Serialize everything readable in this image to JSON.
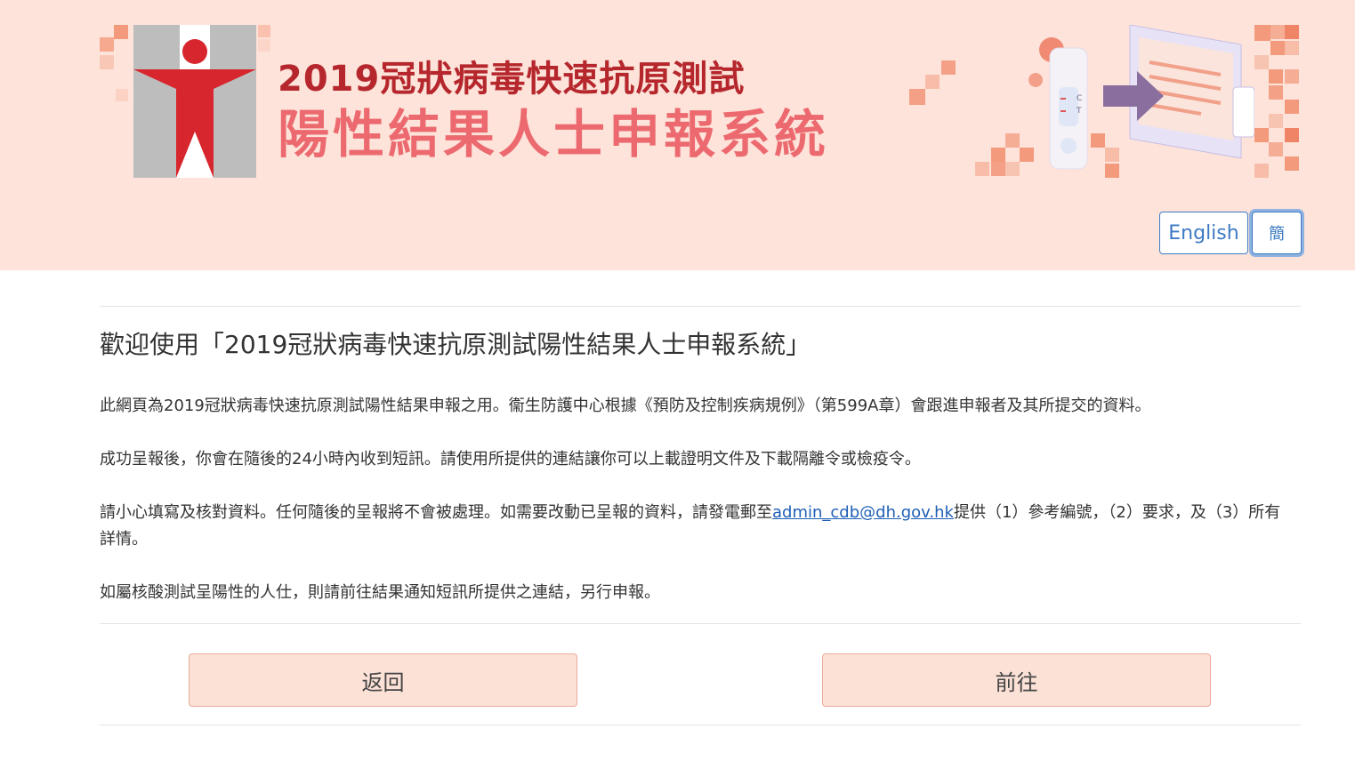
{
  "header": {
    "title_line1": "2019冠狀病毒快速抗原測試",
    "title_line2": "陽性結果人士申報系統",
    "brand_red": "#b5272c",
    "brand_pink": "#ec6a6f",
    "logo_icon": "department-of-health-logo-icon",
    "illustration_icon": "rapid-test-to-computer-illustration-icon",
    "test_kit_text": [
      "C",
      "T"
    ]
  },
  "language": {
    "english_label": "English",
    "simplified_label": "簡"
  },
  "main": {
    "welcome_title": "歡迎使用「2019冠狀病毒快速抗原測試陽性結果人士申報系統」",
    "para1": "此網頁為2019冠狀病毒快速抗原測試陽性結果申報之用。衞生防護中心根據《預防及控制疾病規例》（第599A章）會跟進申報者及其所提交的資料。",
    "para2": "成功呈報後，你會在隨後的24小時內收到短訊。請使用所提供的連結讓你可以上載證明文件及下載隔離令或檢疫令。",
    "para3_before": "請小心填寫及核對資料。任何隨後的呈報將不會被處理。如需要改動已呈報的資料，請發電郵至",
    "para3_email": "admin_cdb@dh.gov.hk",
    "para3_after": "提供（1）參考編號，（2）要求，及（3）所有詳情。",
    "para4": "如屬核酸測試呈陽性的人仕，則請前往結果通知短訊所提供之連結，另行申報。"
  },
  "actions": {
    "back_label": "返回",
    "proceed_label": "前往"
  }
}
